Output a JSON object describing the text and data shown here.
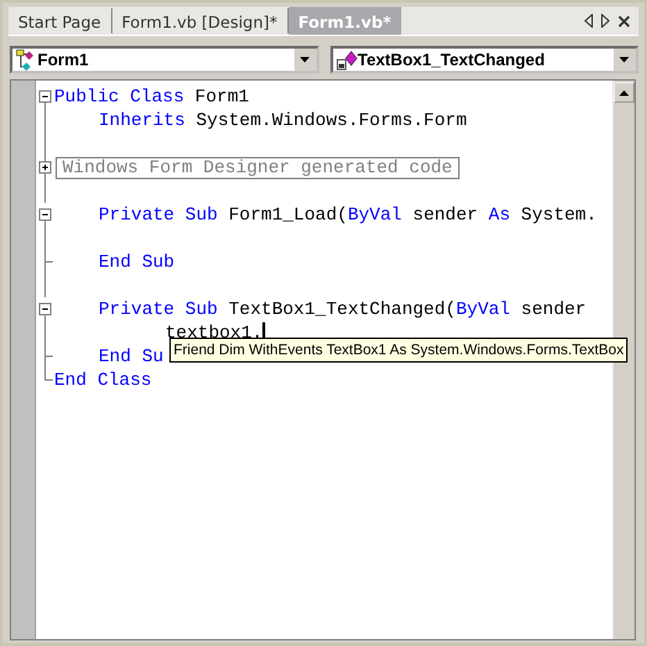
{
  "tabs": [
    {
      "label": "Start Page",
      "selected": false
    },
    {
      "label": "Form1.vb [Design]*",
      "selected": false
    },
    {
      "label": "Form1.vb*",
      "selected": true
    }
  ],
  "class_dropdown": {
    "value": "Form1"
  },
  "method_dropdown": {
    "value": "TextBox1_TextChanged"
  },
  "code": {
    "lines": [
      {
        "kind": "open",
        "segments": [
          {
            "text": "Public Class",
            "kind": "keyword"
          },
          {
            "text": " Form1",
            "kind": "plain"
          }
        ],
        "children": [
          {
            "kind": "body",
            "segments": [
              {
                "text": "Inherits",
                "kind": "keyword"
              },
              {
                "text": " System.Windows.Forms.Form",
                "kind": "plain"
              }
            ]
          },
          {
            "kind": "body"
          },
          {
            "kind": "collapsed",
            "segments": [
              {
                "text": "Windows Form Designer generated code",
                "kind": "region"
              }
            ]
          },
          {
            "kind": "body"
          },
          {
            "kind": "open",
            "segments": [
              {
                "text": "Private Sub",
                "kind": "keyword"
              },
              {
                "text": " Form1_Load(",
                "kind": "plain"
              },
              {
                "text": "ByVal",
                "kind": "keyword"
              },
              {
                "text": " sender ",
                "kind": "plain"
              },
              {
                "text": "As",
                "kind": "keyword"
              },
              {
                "text": " System.",
                "kind": "plain"
              }
            ],
            "children": [
              {
                "kind": "body"
              }
            ]
          },
          {
            "kind": "end",
            "segments": [
              {
                "text": "End Sub",
                "kind": "keyword"
              }
            ]
          },
          {
            "kind": "body"
          },
          {
            "kind": "open",
            "segments": [
              {
                "text": "Private Sub",
                "kind": "keyword"
              },
              {
                "text": " TextBox1_TextChanged(",
                "kind": "plain"
              },
              {
                "text": "ByVal",
                "kind": "keyword"
              },
              {
                "text": " sender ",
                "kind": "plain"
              }
            ],
            "children": [
              {
                "kind": "body",
                "caret": true,
                "segments": [
                  {
                    "text": "textbox1.",
                    "kind": "plain"
                  }
                ]
              }
            ]
          },
          {
            "kind": "end",
            "segments": [
              {
                "text": "End Su",
                "kind": "keyword"
              }
            ]
          }
        ]
      },
      {
        "kind": "last",
        "segments": [
          {
            "text": "End Class",
            "kind": "keyword"
          }
        ]
      }
    ]
  },
  "tooltip": {
    "text": "Friend Dim WithEvents TextBox1 As System.Windows.Forms.TextBox"
  }
}
